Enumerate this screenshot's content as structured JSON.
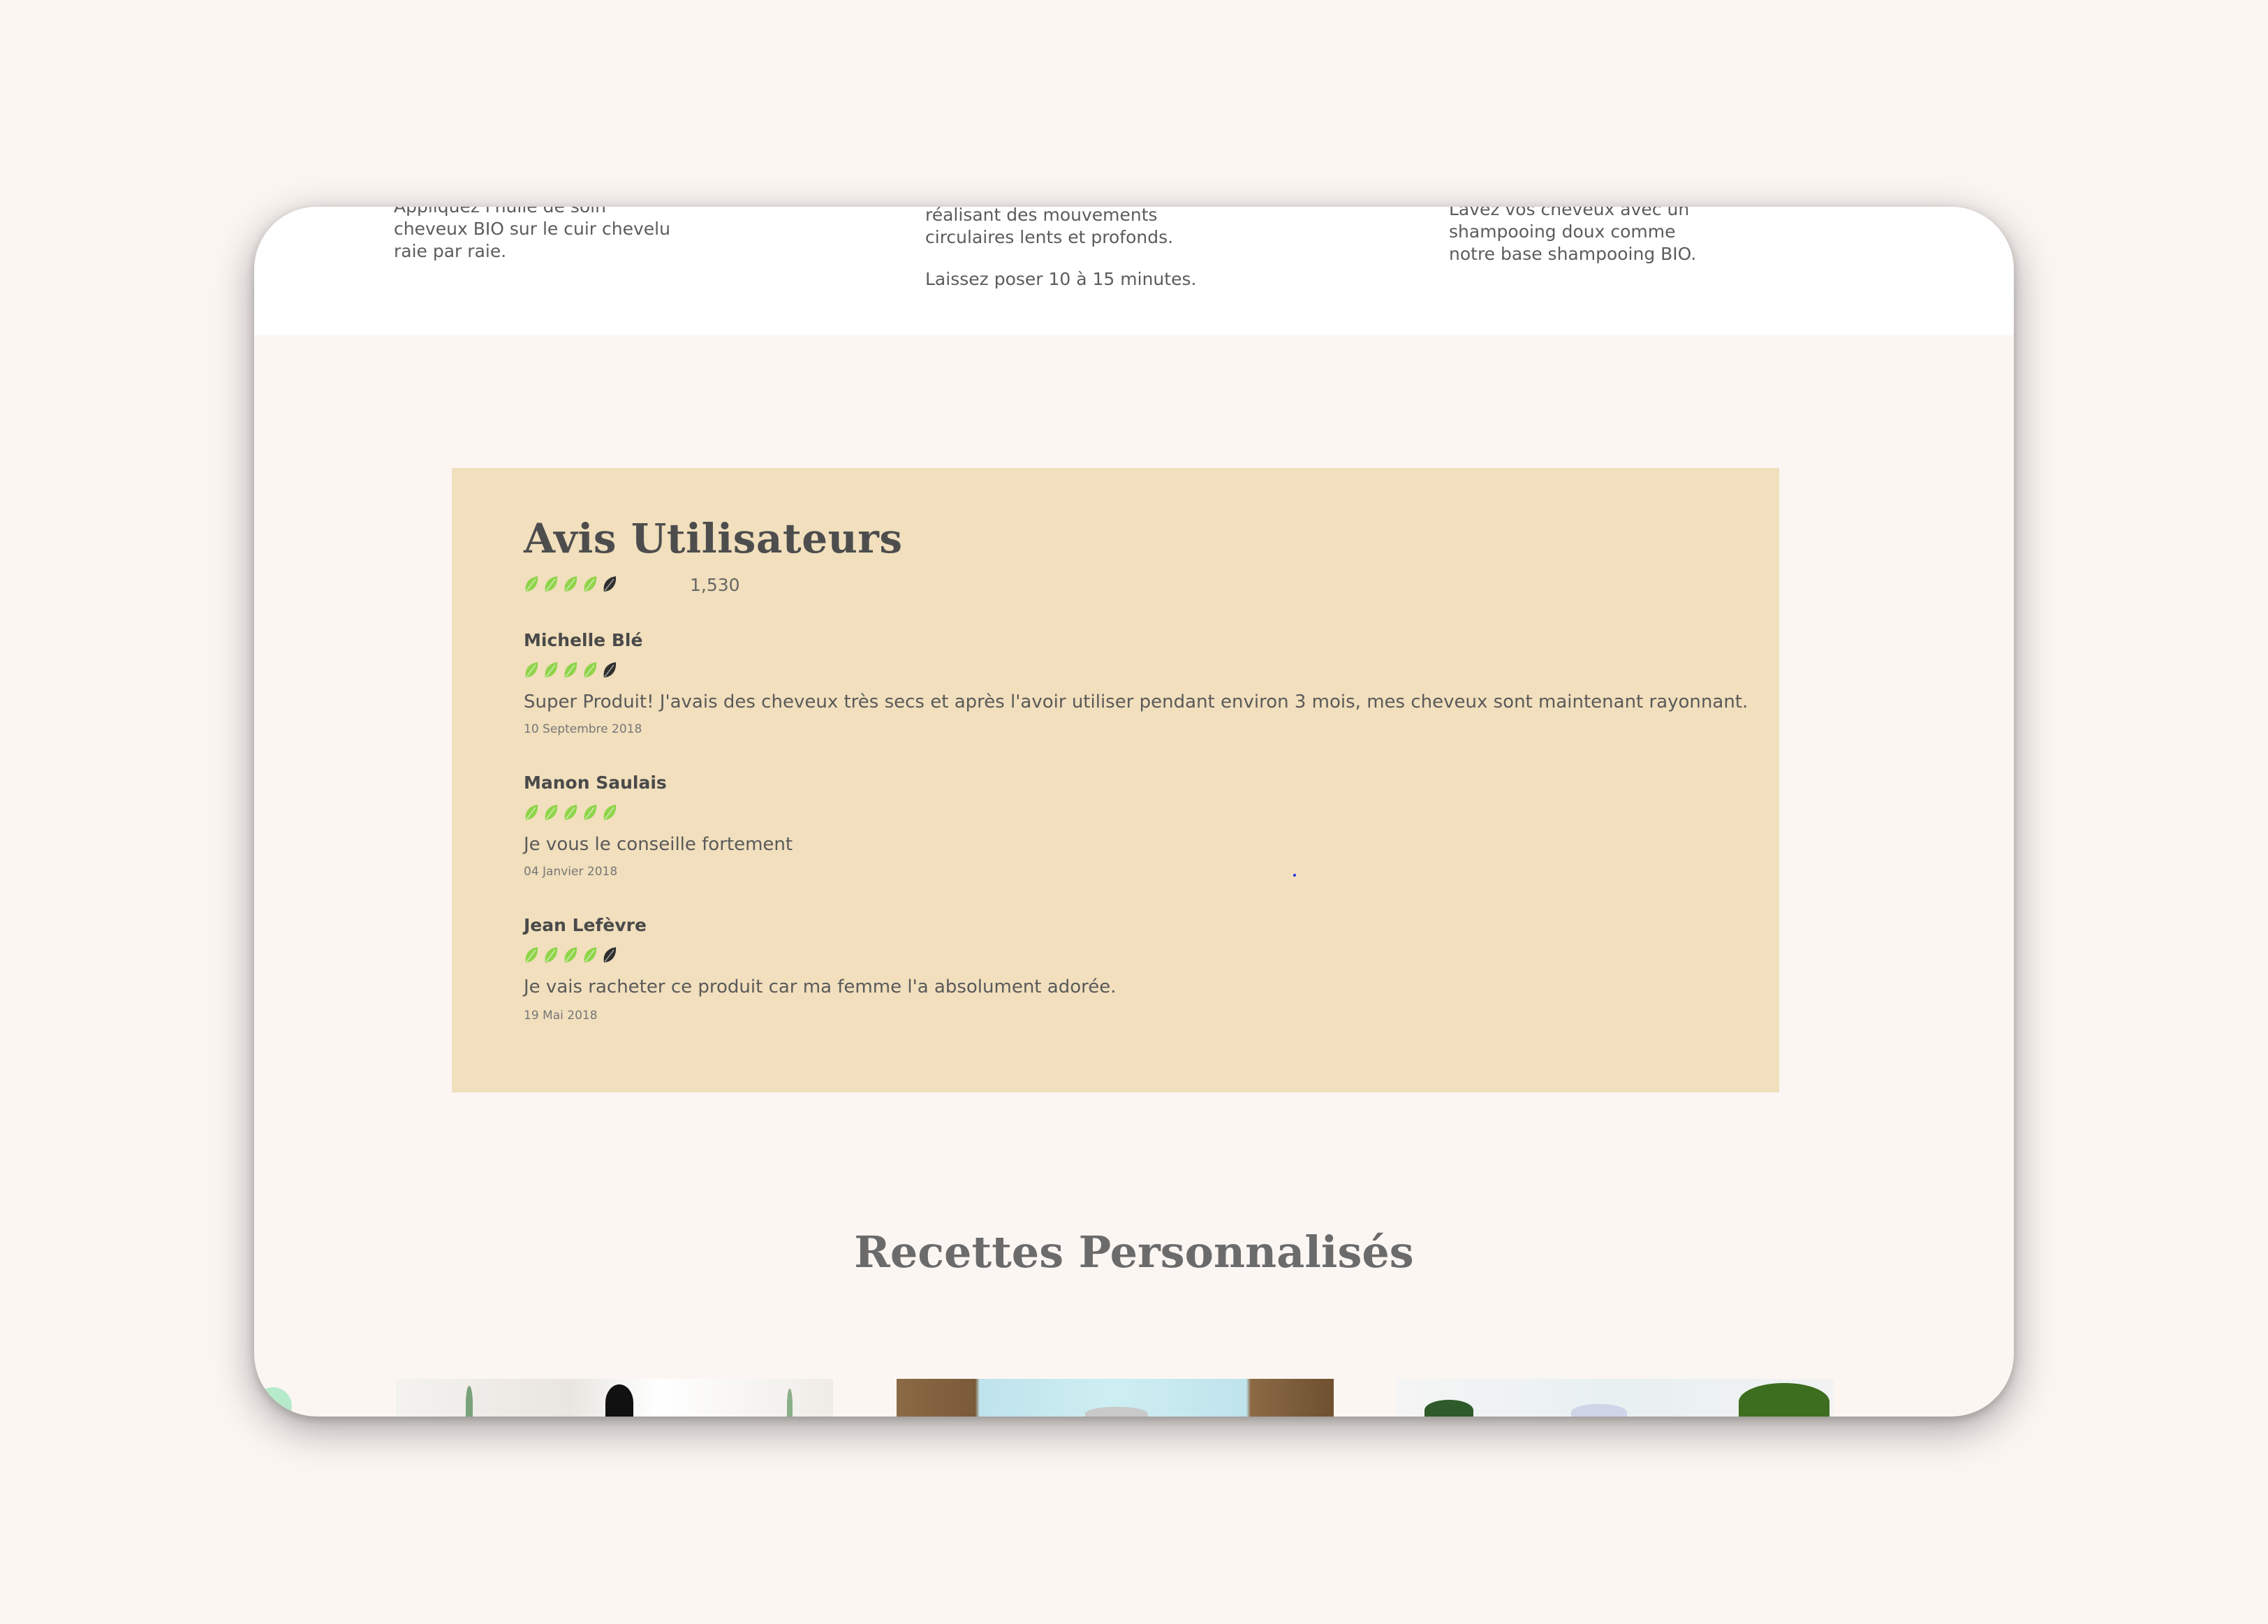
{
  "steps": [
    {
      "lines": [
        "Appliquez l'huile de soin",
        "cheveux BIO sur le cuir chevelu",
        "raie par raie."
      ]
    },
    {
      "lines": [
        "réalisant des mouvements",
        "circulaires lents et profonds."
      ],
      "extra": "Laissez poser 10 à 15 minutes."
    },
    {
      "lines": [
        "Lavez vos cheveux avec un",
        "shampooing doux comme",
        "notre base shampooing BIO."
      ]
    }
  ],
  "reviews": {
    "title": "Avis Utilisateurs",
    "rating": 4,
    "count": "1,530",
    "items": [
      {
        "name": "Michelle Blé",
        "rating": 4,
        "text": "Super Produit! J'avais des cheveux très secs et après l'avoir utiliser pendant environ 3 mois, mes cheveux sont maintenant rayonnant.",
        "date": "10 Septembre 2018"
      },
      {
        "name": "Manon Saulais",
        "rating": 5,
        "text": "Je vous le conseille fortement",
        "date": "04 Janvier 2018"
      },
      {
        "name": "Jean Lefèvre",
        "rating": 4,
        "text": "Je vais racheter ce produit car ma femme l'a absolument adorée.",
        "date": "19 Mai 2018"
      }
    ]
  },
  "recipes": {
    "title": "Recettes Personnalisés"
  },
  "colors": {
    "leaf_active": "#8fd44a",
    "leaf_inactive": "#2f2f2f",
    "panel": "#f1dfbd",
    "page_bg": "#fcf6f3"
  },
  "icons": [
    "leaf-icon"
  ]
}
